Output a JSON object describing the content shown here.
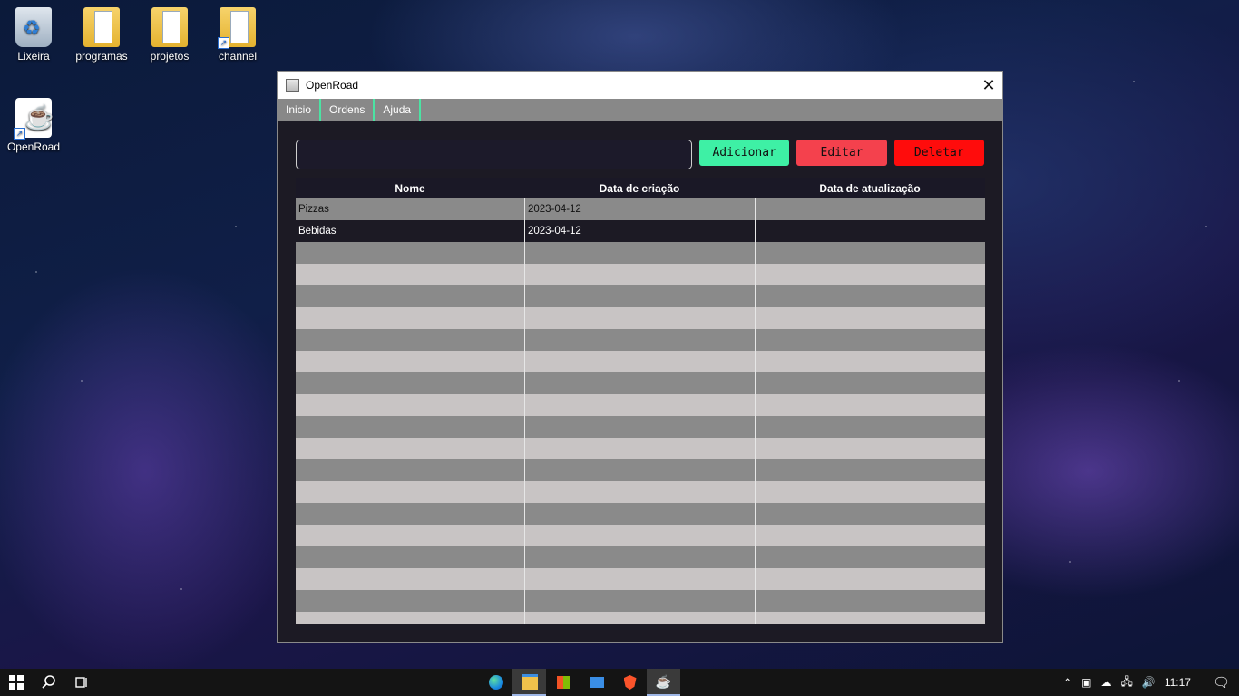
{
  "desktop": {
    "icons": [
      {
        "label": "Lixeira",
        "icon": "recycle-bin-icon"
      },
      {
        "label": "programas",
        "icon": "folder-icon"
      },
      {
        "label": "projetos",
        "icon": "folder-icon"
      },
      {
        "label": "channel",
        "icon": "folder-shortcut-icon"
      },
      {
        "label": "OpenRoad",
        "icon": "java-icon"
      }
    ]
  },
  "window": {
    "title": "OpenRoad",
    "close_symbol": "✕",
    "menu": [
      "Inicio",
      "Ordens",
      "Ajuda"
    ],
    "search": {
      "value": "",
      "placeholder": ""
    },
    "buttons": {
      "add": "Adicionar",
      "edit": "Editar",
      "delete": "Deletar"
    },
    "table": {
      "headers": [
        "Nome",
        "Data de criação",
        "Data de atualização"
      ],
      "rows": [
        [
          "Pizzas",
          "2023-04-12",
          ""
        ],
        [
          "Bebidas",
          "2023-04-12",
          ""
        ]
      ]
    }
  },
  "colors": {
    "add_button": "#3ef0a5",
    "edit_button": "#f4414d",
    "delete_button": "#ff0c0c",
    "menu_separator": "#4be3a3"
  },
  "taskbar": {
    "apps": [
      "start-icon",
      "search-icon",
      "task-view-icon",
      "edge-icon",
      "file-explorer-icon",
      "store-icon",
      "mail-icon",
      "brave-icon",
      "java-icon"
    ],
    "tray": [
      "chevron-up-icon",
      "meet-icon",
      "onedrive-icon",
      "network-icon",
      "volume-icon"
    ],
    "time": "11:17",
    "notifications_icon": "notification-icon"
  }
}
